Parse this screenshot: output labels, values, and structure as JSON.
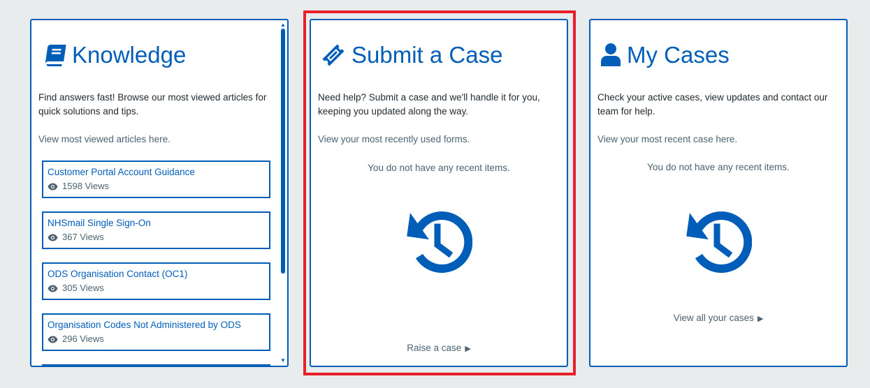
{
  "colors": {
    "brand": "#005eb8",
    "highlight": "#e8202a",
    "background": "#e8eced"
  },
  "knowledge": {
    "icon": "book-icon",
    "title": "Knowledge",
    "description": "Find answers fast! Browse our most viewed articles for quick solutions and tips.",
    "sub": "View most viewed articles here.",
    "articles": [
      {
        "title": "Customer Portal Account Guidance",
        "views": "1598 Views"
      },
      {
        "title": "NHSmail Single Sign-On",
        "views": "367 Views"
      },
      {
        "title": "ODS Organisation Contact (OC1)",
        "views": "305 Views"
      },
      {
        "title": "Organisation Codes Not Administered by ODS",
        "views": "296 Views"
      }
    ]
  },
  "submit": {
    "icon": "ticket-icon",
    "title": "Submit a Case",
    "description": "Need help? Submit a case and we'll handle it for you, keeping you updated along the way.",
    "sub": "View your most recently used forms.",
    "empty": "You do not have any recent items.",
    "link": "Raise a case"
  },
  "mycases": {
    "icon": "user-icon",
    "title": "My Cases",
    "description": "Check your active cases, view updates and contact our team for help.",
    "sub": "View your most recent case here.",
    "empty": "You do not have any recent items.",
    "link": "View all your cases"
  }
}
